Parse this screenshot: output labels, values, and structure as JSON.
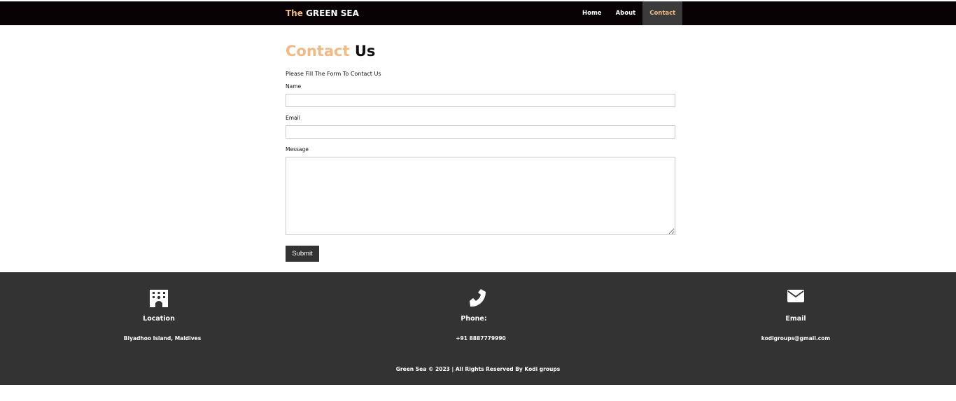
{
  "header": {
    "brand_prefix": "The",
    "brand_name": "GREEN SEA",
    "nav": [
      {
        "label": "Home"
      },
      {
        "label": "About"
      },
      {
        "label": "Contact"
      }
    ]
  },
  "contact": {
    "title_accent": "Contact",
    "title_rest": "Us",
    "intro": "Please Fill The Form To Contact Us",
    "name_label": "Name",
    "name_value": "",
    "email_label": "Email",
    "email_value": "",
    "message_label": "Message",
    "message_value": "",
    "submit_label": "Submit"
  },
  "footer": {
    "location": {
      "icon": "building-icon",
      "heading": "Location",
      "text": "Biyadhoo Island, Maldives"
    },
    "phone": {
      "icon": "phone-icon",
      "heading": "Phone:",
      "text": "+91 8887779990"
    },
    "email": {
      "icon": "envelope-icon",
      "heading": "Email",
      "text": "kodigroups@gmail.com"
    },
    "copyright": "Green Sea © 2023 | All Rights Reserved By Kodi groups"
  },
  "colors": {
    "accent": "#f2b984",
    "nav_bg": "#080204",
    "footer_bg": "#333333",
    "button_bg": "#333333"
  }
}
